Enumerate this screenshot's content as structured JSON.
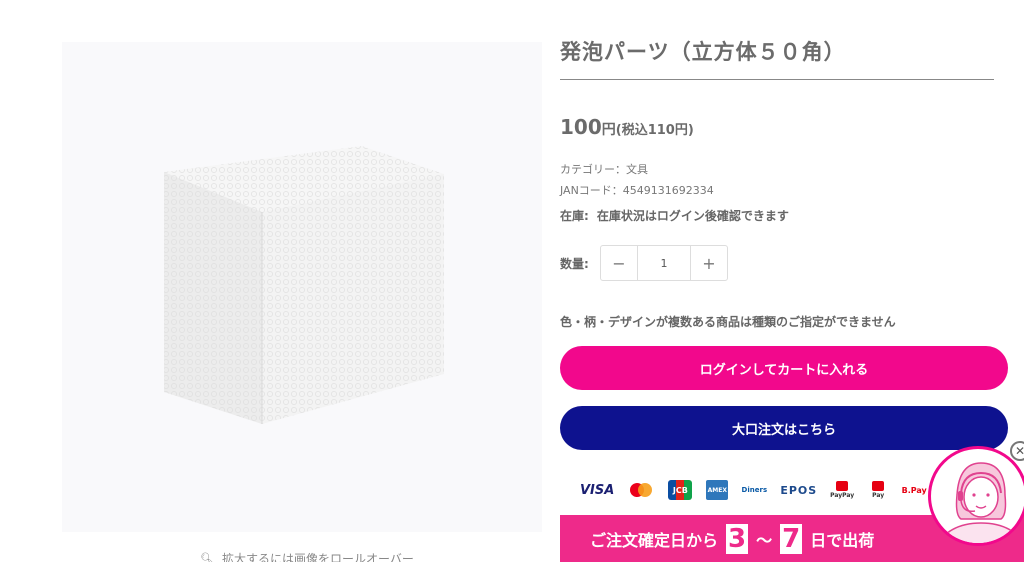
{
  "product": {
    "title": "発泡パーツ（立方体５０角）",
    "price_amount": "100",
    "price_yen": "円",
    "price_tax": "(税込110円)",
    "category": "カテゴリー：文具",
    "jan": "JANコード：4549131692334",
    "stock_label": "在庫:",
    "stock_text": "在庫状況はログイン後確認できます",
    "qty_label": "数量:",
    "qty_value": "1",
    "qty_minus": "−",
    "qty_plus": "+",
    "notice": "色・柄・デザインが複数ある商品は種類のご指定ができません",
    "login_cart_label": "ログインしてカートに入れる",
    "bulk_order_label": "大口注文はこちら"
  },
  "gallery": {
    "zoom_hint": "拡大するには画像をロールオーバー"
  },
  "payments": {
    "visa": "VISA",
    "jcb": "JCB",
    "amex": "AMEX",
    "diners": "Diners",
    "epos": "EPOS",
    "paypay": "PayPay",
    "rpay": "Pay",
    "bpay": "B.Pay"
  },
  "shipping_banner": {
    "prefix": "ご注文確定日から",
    "num_from": "3",
    "tilde": "〜",
    "num_to": "7",
    "suffix": "日で出荷"
  },
  "colors": {
    "cta_pink": "#f2088c",
    "cta_navy": "#0e128f"
  }
}
